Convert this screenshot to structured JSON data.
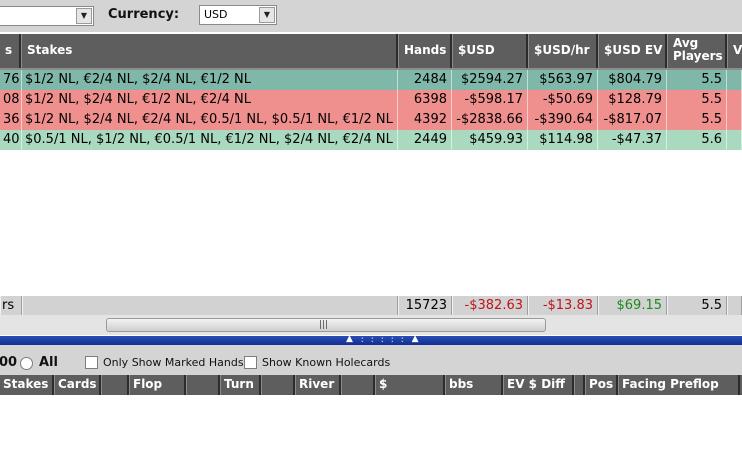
{
  "filter_bar": {
    "dropdown1_value": "",
    "currency_label": "Currency:",
    "currency_value": "USD"
  },
  "columns": {
    "c0": "s",
    "stakes": "Stakes",
    "hands": "Hands",
    "usd": "$USD",
    "usd_hr": "$USD/hr",
    "usd_ev": "$USD EV",
    "avg_players": "Avg Players",
    "last": "V"
  },
  "rows": [
    {
      "c0": "76",
      "stakes": "$1/2 NL, €2/4 NL, $2/4 NL, €1/2 NL",
      "hands": "2484",
      "usd": "$2594.27",
      "usd_hr": "$563.97",
      "usd_ev": "$804.79",
      "avg_players": "5.5",
      "color": "#7fb7a8"
    },
    {
      "c0": "08",
      "stakes": "$1/2 NL, $2/4 NL, €1/2 NL, €2/4 NL",
      "hands": "6398",
      "usd": "-$598.17",
      "usd_hr": "-$50.69",
      "usd_ev": "$128.79",
      "avg_players": "5.5",
      "color": "#f0908e"
    },
    {
      "c0": "36",
      "stakes": "$1/2 NL, $2/4 NL, €2/4 NL, €0.5/1 NL, $0.5/1 NL, €1/2 NL",
      "hands": "4392",
      "usd": "-$2838.66",
      "usd_hr": "-$390.64",
      "usd_ev": "-$817.07",
      "avg_players": "5.5",
      "color": "#f0908e"
    },
    {
      "c0": "40",
      "stakes": "$0.5/1 NL, $1/2 NL, €0.5/1 NL, €1/2 NL, $2/4 NL, €2/4 NL",
      "hands": "2449",
      "usd": "$459.93",
      "usd_hr": "$114.98",
      "usd_ev": "-$47.37",
      "avg_players": "5.6",
      "color": "#a9d9bf"
    }
  ],
  "totals": {
    "c0": "rs",
    "hands": "15723",
    "usd": "-$382.63",
    "usd_hr": "-$13.83",
    "usd_ev": "$69.15",
    "avg_players": "5.5",
    "neg_color": "#c0141c",
    "pos_color": "#1c8a1c"
  },
  "lower_filter": {
    "partial_value": "00",
    "all_label": "All",
    "only_marked_label": "Only Show Marked Hands",
    "known_holecards_label": "Show Known Holecards"
  },
  "lower_columns": {
    "stakes": "Stakes",
    "cards": "Cards",
    "flop": "Flop",
    "turn": "Turn",
    "river": "River",
    "dollar": "$",
    "bbs": "bbs",
    "ev_diff": "EV $ Diff",
    "pos": "Pos",
    "facing_preflop": "Facing Preflop"
  }
}
